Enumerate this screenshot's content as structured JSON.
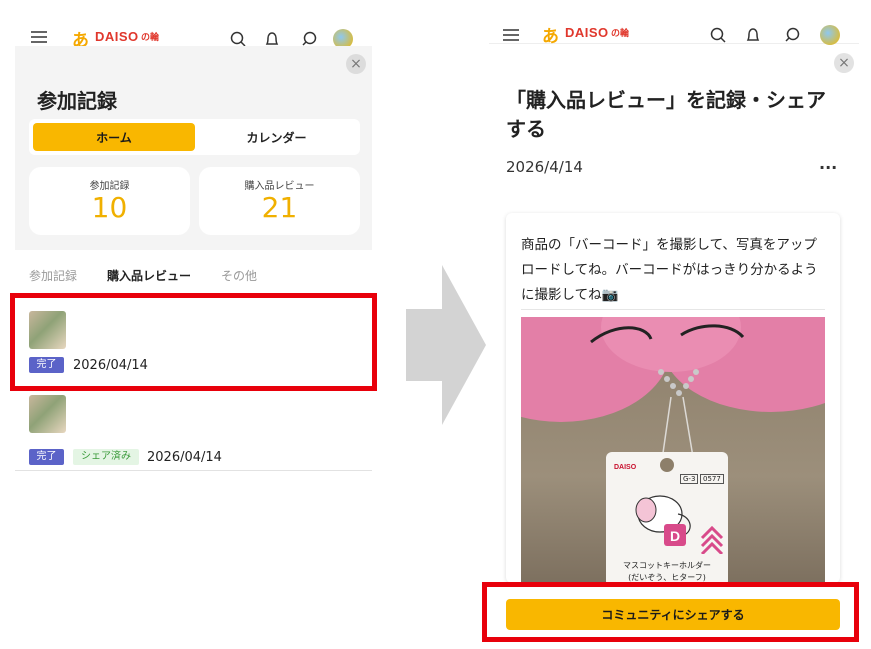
{
  "left": {
    "logo": {
      "mark": "あ",
      "text": "DAISO",
      "suffix": "の輪"
    },
    "close_glyph": "×",
    "title": "参加記録",
    "tabs": {
      "home": "ホーム",
      "calendar": "カレンダー"
    },
    "stats": [
      {
        "label": "参加記録",
        "value": "10"
      },
      {
        "label": "購入品レビュー",
        "value": "21"
      }
    ],
    "subtabs": [
      "参加記録",
      "購入品レビュー",
      "その他"
    ],
    "records": [
      {
        "badge": "完了",
        "shared": "",
        "date": "2026/04/14"
      },
      {
        "badge": "完了",
        "shared": "シェア済み",
        "date": "2026/04/14"
      }
    ]
  },
  "right": {
    "logo": {
      "mark": "あ",
      "text": "DAISO",
      "suffix": "の輪"
    },
    "close_glyph": "×",
    "title": "「購入品レビュー」を記録・シェアする",
    "date": "2026/4/14",
    "more_glyph": "···",
    "instruction": "商品の「バーコード」を撮影して、写真をアップロードしてね。バーコードがはっきり分かるように撮影してね📷",
    "tag": {
      "brand": "DAISO",
      "code": "G-3",
      "number": "0577",
      "line1": "マスコットキーホルダー",
      "line2": "(だいぞう、ヒターフ)"
    },
    "share_button": "コミュニティにシェアする"
  },
  "colors": {
    "accent": "#f9b700",
    "highlight": "#e8000b",
    "done_badge": "#5b63c8"
  }
}
